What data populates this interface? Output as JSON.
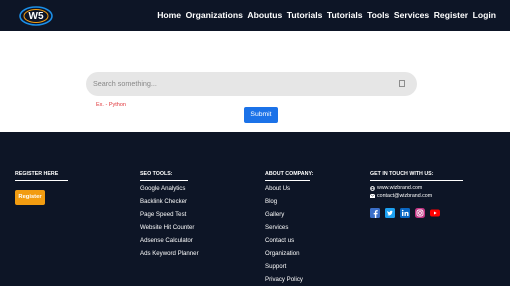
{
  "navbar": {
    "logo_text": "W5",
    "links": [
      "Home",
      "Organizations",
      "Aboutus",
      "Tutorials",
      "Tutorials",
      "Tools",
      "Services",
      "Register",
      "Login"
    ]
  },
  "search": {
    "placeholder": "Search something...",
    "hint": "Ex. - Python",
    "submit_label": "Submit"
  },
  "footer": {
    "register": {
      "title": "REGISTER HERE",
      "button_label": "Register"
    },
    "seo_tools": {
      "title": "SEO TOOLS:",
      "items": [
        "Google Analytics",
        "Backlink Checker",
        "Page Speed Test",
        "Website Hit Counter",
        "Adsense Calculator",
        "Ads Keyword Planner"
      ]
    },
    "about": {
      "title": "ABOUT COMPANY:",
      "items": [
        "About Us",
        "Blog",
        "Gallery",
        "Services",
        "Contact us",
        "Organization",
        "Support",
        "Privacy Policy"
      ]
    },
    "contact": {
      "title": "GET IN TOUCH WITH US:",
      "website": "www.wizbrand.com",
      "email": "contact@wizbrand.com",
      "social_icons": [
        "facebook-icon",
        "twitter-icon",
        "linkedin-icon",
        "instagram-icon",
        "youtube-icon"
      ]
    }
  },
  "colors": {
    "dark_bg": "#0d1526",
    "accent_blue": "#1b72e8",
    "register_orange": "#f29c11",
    "hint_red": "#e0353a"
  }
}
